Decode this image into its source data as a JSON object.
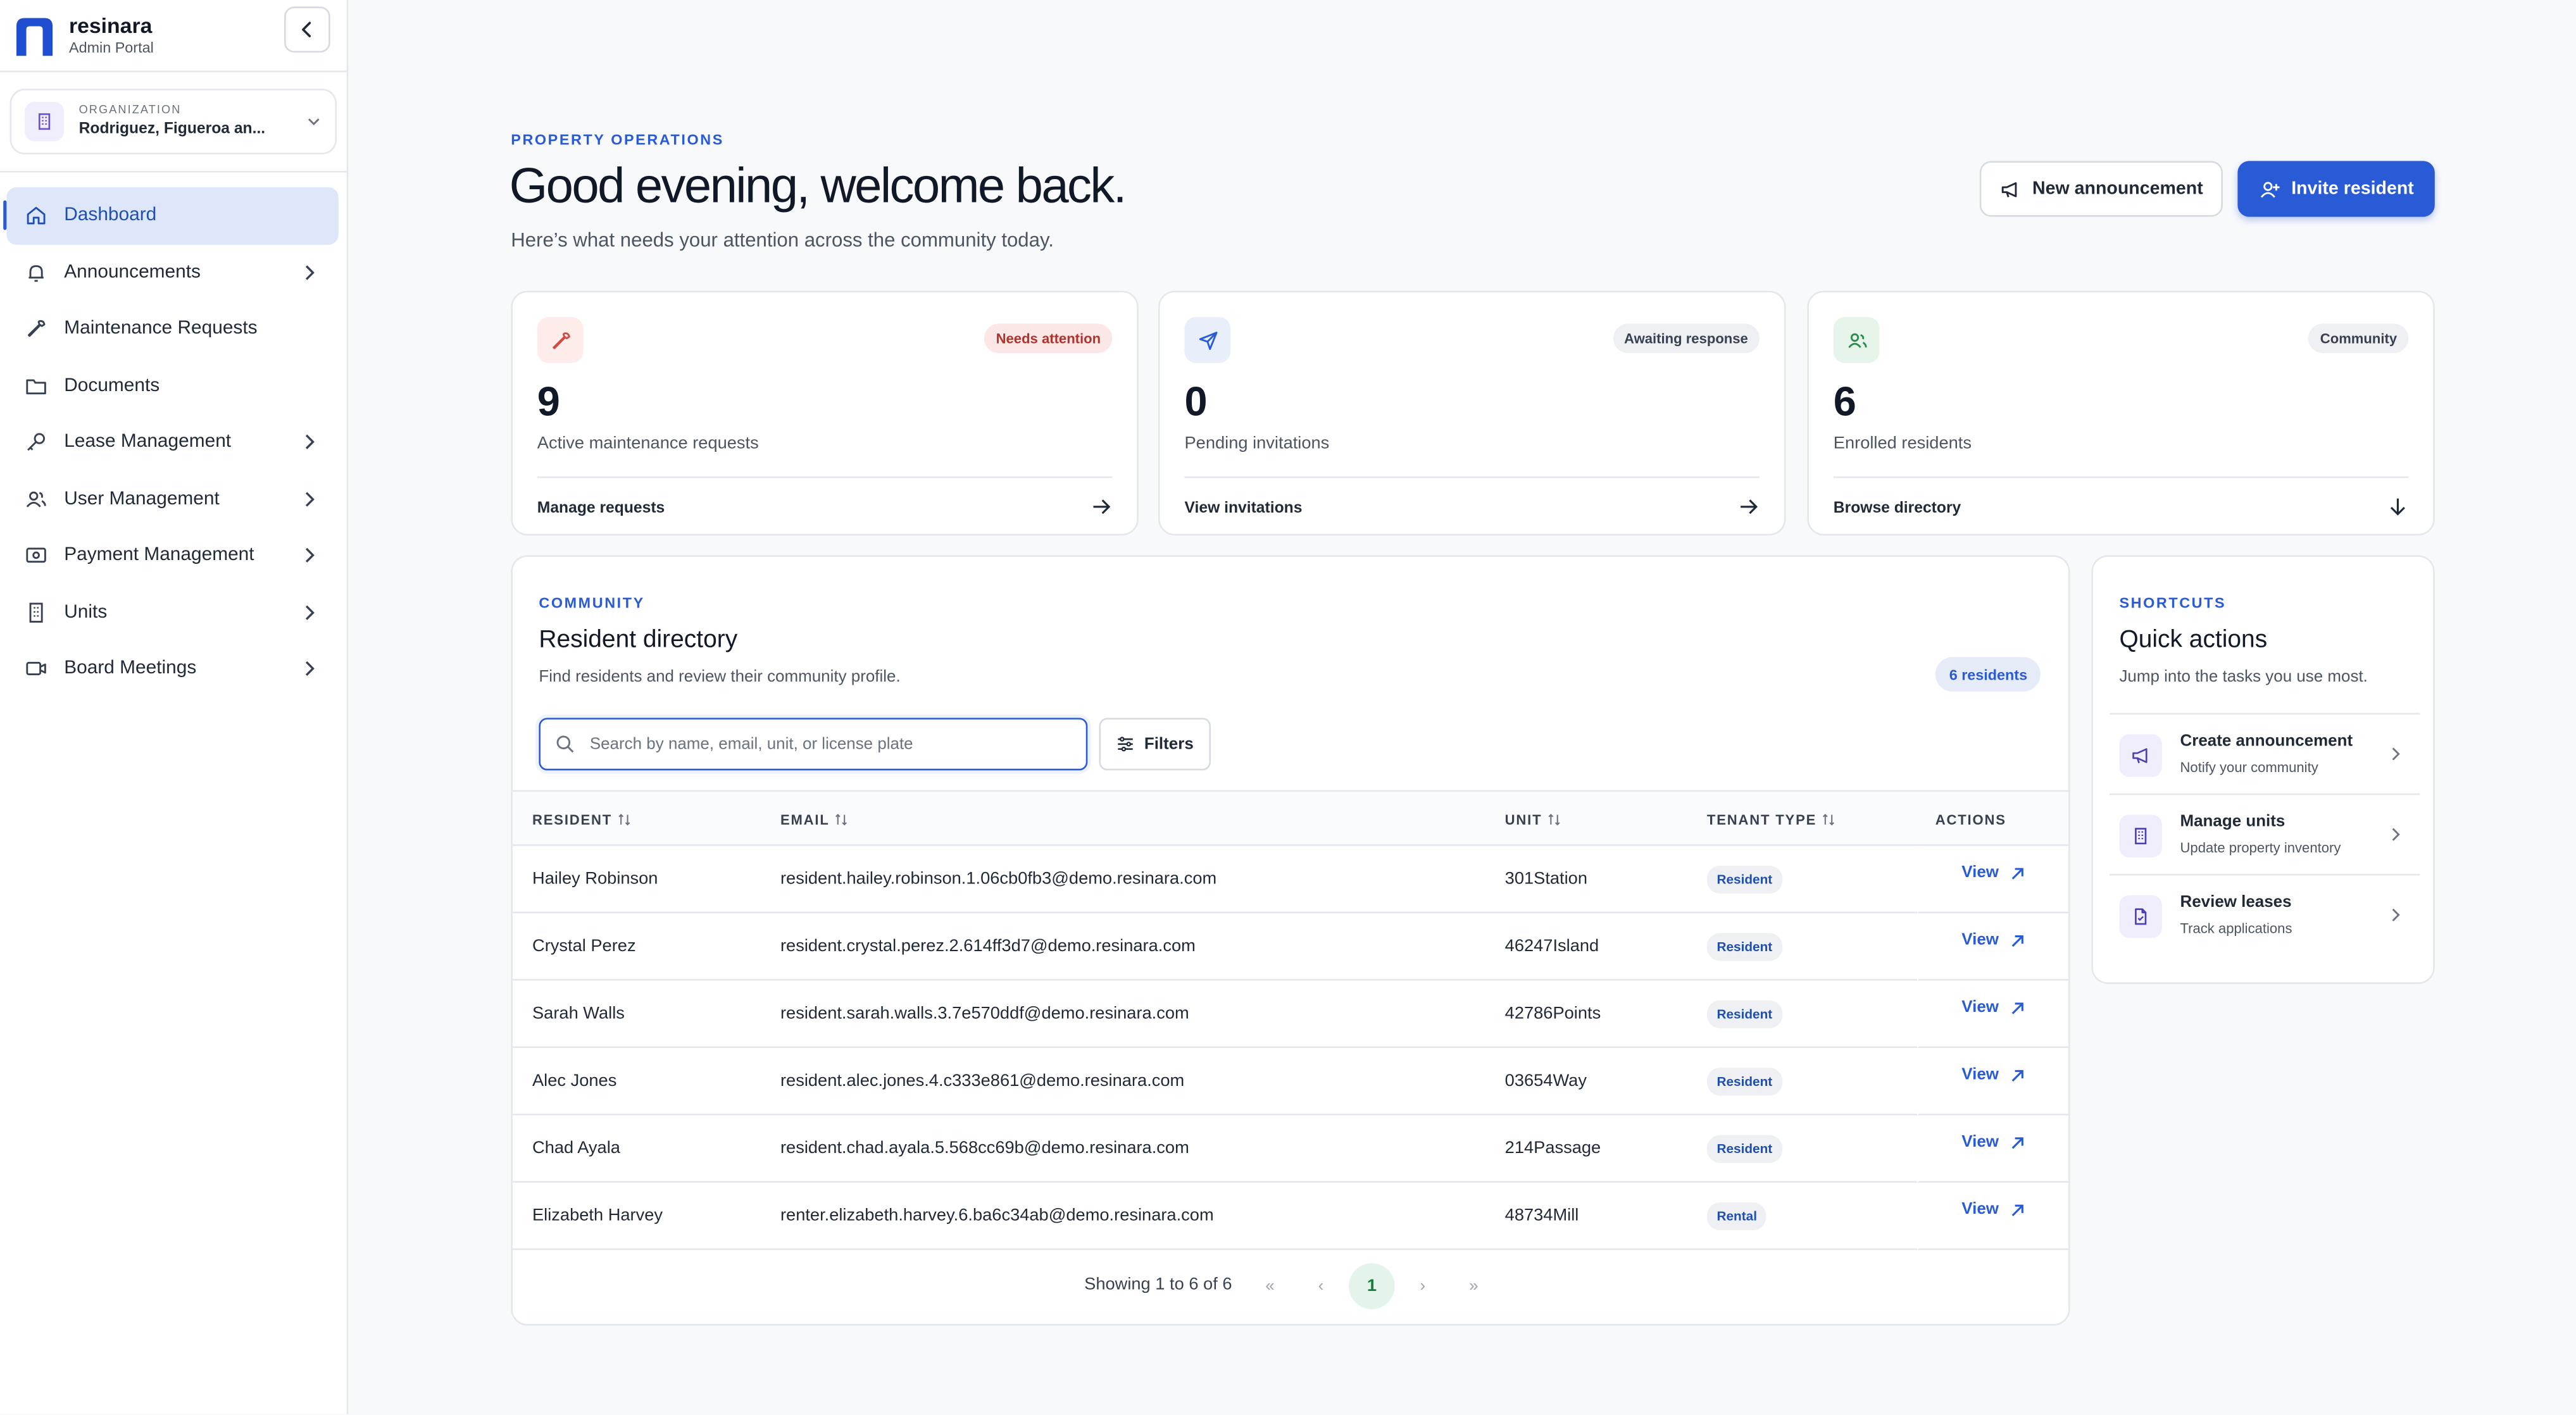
{
  "app": {
    "name": "resinara",
    "subtitle": "Admin Portal"
  },
  "organization": {
    "label": "ORGANIZATION",
    "name": "Rodriguez, Figueroa an..."
  },
  "sidebar": {
    "items": [
      {
        "label": "Dashboard",
        "icon": "home-icon",
        "active": true,
        "chevron": false
      },
      {
        "label": "Announcements",
        "icon": "bell-icon",
        "chevron": true
      },
      {
        "label": "Maintenance Requests",
        "icon": "wrench-icon",
        "chevron": false
      },
      {
        "label": "Documents",
        "icon": "folder-icon",
        "chevron": false
      },
      {
        "label": "Lease Management",
        "icon": "key-icon",
        "chevron": true
      },
      {
        "label": "User Management",
        "icon": "users-icon",
        "chevron": true
      },
      {
        "label": "Payment Management",
        "icon": "banknote-icon",
        "chevron": true
      },
      {
        "label": "Units",
        "icon": "building-icon",
        "chevron": true
      },
      {
        "label": "Board Meetings",
        "icon": "video-icon",
        "chevron": true
      }
    ]
  },
  "header": {
    "eyebrow": "PROPERTY OPERATIONS",
    "title": "Good evening, welcome back.",
    "subtitle": "Here’s what needs your attention across the community today.",
    "new_announcement": "New announcement",
    "invite_resident": "Invite resident"
  },
  "stats": [
    {
      "value": "9",
      "label": "Active maintenance requests",
      "badge": "Needs attention",
      "footer": "Manage requests",
      "icon": "wrench-icon",
      "badge_bg": "#fbe7e6",
      "badge_color": "#b4322b",
      "icon_bg": "#fdecea",
      "icon_color": "#d24b3f"
    },
    {
      "value": "0",
      "label": "Pending invitations",
      "badge": "Awaiting response",
      "footer": "View invitations",
      "icon": "send-icon",
      "badge_bg": "#eef0f3",
      "badge_color": "#374151",
      "icon_bg": "#e8eefa",
      "icon_color": "#2a5bd7"
    },
    {
      "value": "6",
      "label": "Enrolled residents",
      "badge": "Community",
      "footer": "Browse directory",
      "icon": "users-icon",
      "badge_bg": "#eef0f3",
      "badge_color": "#374151",
      "icon_bg": "#e6f4ea",
      "icon_color": "#2f8a4f"
    }
  ],
  "directory": {
    "eyebrow": "COMMUNITY",
    "title": "Resident directory",
    "subtitle": "Find residents and review their community profile.",
    "count": "6 residents",
    "search_placeholder": "Search by name, email, unit, or license plate",
    "filters": "Filters",
    "columns": [
      "RESIDENT",
      "EMAIL",
      "UNIT",
      "TENANT TYPE",
      "ACTIONS"
    ],
    "rows": [
      {
        "name": "Hailey Robinson",
        "email": "resident.hailey.robinson.1.06cb0fb3@demo.resinara.com",
        "unit": "301Station",
        "type": "Resident",
        "action": "View"
      },
      {
        "name": "Crystal Perez",
        "email": "resident.crystal.perez.2.614ff3d7@demo.resinara.com",
        "unit": "46247Island",
        "type": "Resident",
        "action": "View"
      },
      {
        "name": "Sarah Walls",
        "email": "resident.sarah.walls.3.7e570ddf@demo.resinara.com",
        "unit": "42786Points",
        "type": "Resident",
        "action": "View"
      },
      {
        "name": "Alec Jones",
        "email": "resident.alec.jones.4.c333e861@demo.resinara.com",
        "unit": "03654Way",
        "type": "Resident",
        "action": "View"
      },
      {
        "name": "Chad Ayala",
        "email": "resident.chad.ayala.5.568cc69b@demo.resinara.com",
        "unit": "214Passage",
        "type": "Resident",
        "action": "View"
      },
      {
        "name": "Elizabeth Harvey",
        "email": "renter.elizabeth.harvey.6.ba6c34ab@demo.resinara.com",
        "unit": "48734Mill",
        "type": "Rental",
        "action": "View"
      }
    ],
    "pagination": {
      "text": "Showing 1 to 6 of 6",
      "first": "«",
      "prev": "‹",
      "current": "1",
      "next": "›",
      "last": "»"
    }
  },
  "quick_actions": {
    "eyebrow": "SHORTCUTS",
    "title": "Quick actions",
    "subtitle": "Jump into the tasks you use most.",
    "items": [
      {
        "title": "Create announcement",
        "desc": "Notify your community",
        "icon": "megaphone-icon"
      },
      {
        "title": "Manage units",
        "desc": "Update property inventory",
        "icon": "building-icon"
      },
      {
        "title": "Review leases",
        "desc": "Track applications",
        "icon": "document-icon"
      }
    ]
  },
  "colors": {
    "accent": "#2a5bd7",
    "active_nav_bg": "#dde7f9",
    "background": "#f8f9fb"
  }
}
